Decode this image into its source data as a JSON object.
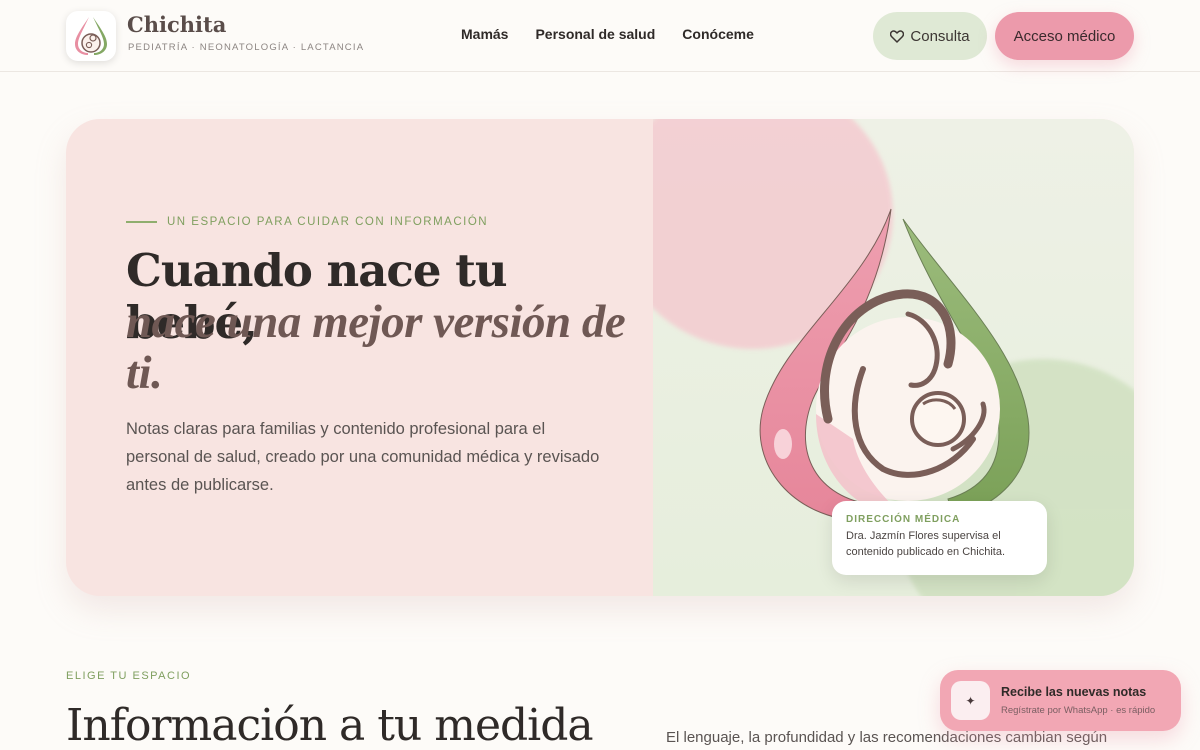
{
  "header": {
    "brand_name": "Chichita",
    "brand_tagline": "PEDIATRÍA · NEONATOLOGÍA · LACTANCIA",
    "nav": [
      "Mamás",
      "Personal de salud",
      "Conóceme"
    ],
    "consulta_label": "Consulta",
    "consulta_icon": "heart-outline-icon",
    "acceso_label": "Acceso médico"
  },
  "hero": {
    "eyebrow": "UN ESPACIO PARA CUIDAR CON INFORMACIÓN",
    "title": "Cuando nace tu bebé,",
    "title_em": "nace una mejor versión de ti.",
    "body": "Notas claras para familias y contenido profesional para el personal de salud, creado por una comunidad médica y revisado antes de publicarse.",
    "card_label": "DIRECCIÓN MÉDICA",
    "card_text": "Dra. Jazmín Flores supervisa el contenido publicado en Chichita."
  },
  "section": {
    "eyebrow": "ELIGE TU ESPACIO",
    "title": "Información a tu medida",
    "body": "El lenguaje, la profundidad y las recomendaciones cambian según"
  },
  "toast": {
    "icon": "sparkle-icon",
    "icon_glyph": "✦",
    "title": "Recibe las nuevas notas",
    "subtitle": "Regístrate por WhatsApp · es rápido"
  },
  "colors": {
    "pink_accent": "#ec9aab",
    "green_accent": "#7f9f5f",
    "hero_bg": "#f8e4e1",
    "consulta_bg": "#dfe9d5"
  }
}
